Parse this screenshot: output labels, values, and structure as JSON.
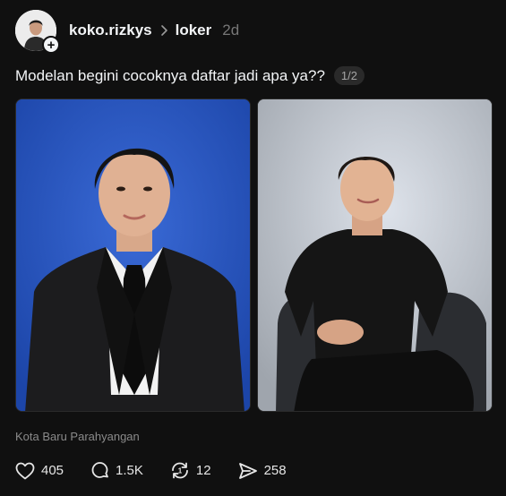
{
  "post": {
    "username": "koko.rizkys",
    "community": "loker",
    "time": "2d",
    "caption": "Modelan begini cocoknya daftar jadi apa ya??",
    "image_counter": "1/2",
    "location": "Kota Baru Parahyangan"
  },
  "actions": {
    "likes": "405",
    "replies": "1.5K",
    "reposts": "12",
    "shares": "258"
  },
  "icons": [
    "plus-icon",
    "chevron-right-icon",
    "heart-icon",
    "comment-icon",
    "repost-icon",
    "send-icon"
  ],
  "colors": {
    "background": "#101010",
    "text": "#f3f5f7",
    "muted": "#777777",
    "photo1_bg": "#2350b8"
  }
}
